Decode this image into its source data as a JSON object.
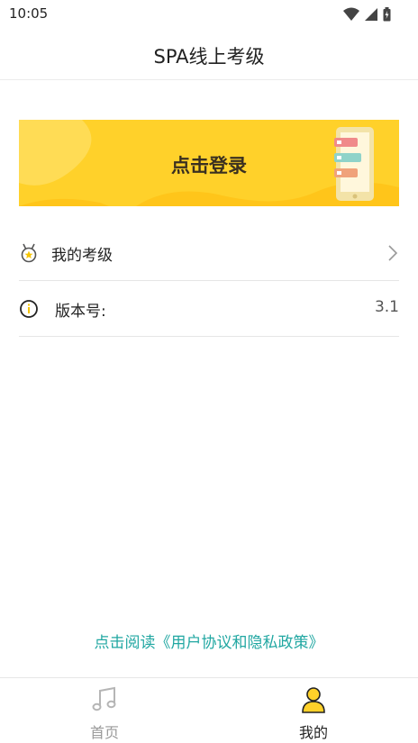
{
  "status_bar": {
    "time": "10:05"
  },
  "header": {
    "title": "SPA线上考级"
  },
  "banner": {
    "login_label": "点击登录"
  },
  "menu": {
    "exams": {
      "label": "我的考级",
      "icon": "medal-icon"
    },
    "version": {
      "label": "版本号:",
      "value": "3.1",
      "icon": "info-icon"
    }
  },
  "policy": {
    "link_text": "点击阅读《用户协议和隐私政策》"
  },
  "tabs": [
    {
      "label": "首页",
      "icon": "music-note-icon",
      "active": false
    },
    {
      "label": "我的",
      "icon": "person-icon",
      "active": true
    }
  ],
  "colors": {
    "accent": "#ffd12a",
    "link": "#21a7a2",
    "active_tab_text": "#222222",
    "inactive_tab_text": "#999999"
  }
}
